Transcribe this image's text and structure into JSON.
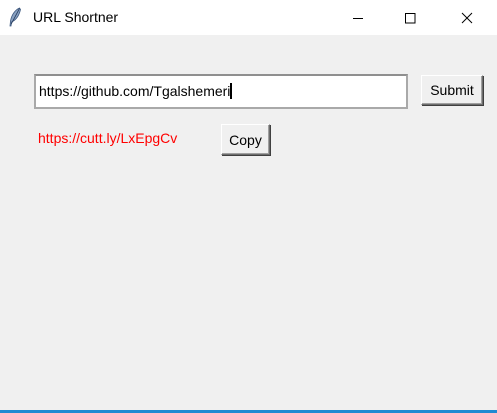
{
  "window": {
    "title": "URL Shortner",
    "icon": "feather-icon",
    "controls": {
      "minimize": "minimize-icon",
      "maximize": "maximize-icon",
      "close": "close-icon"
    }
  },
  "form": {
    "url_value": "https://github.com/Tgalshemeri",
    "submit_label": "Submit"
  },
  "result": {
    "short_url": "https://cutt.ly/LxEpgCv",
    "short_url_color": "#ff0000",
    "copy_label": "Copy"
  },
  "colors": {
    "titlebar_bg": "#ffffff",
    "client_bg": "#f0f0f0",
    "accent_border": "#1f8ad2"
  }
}
